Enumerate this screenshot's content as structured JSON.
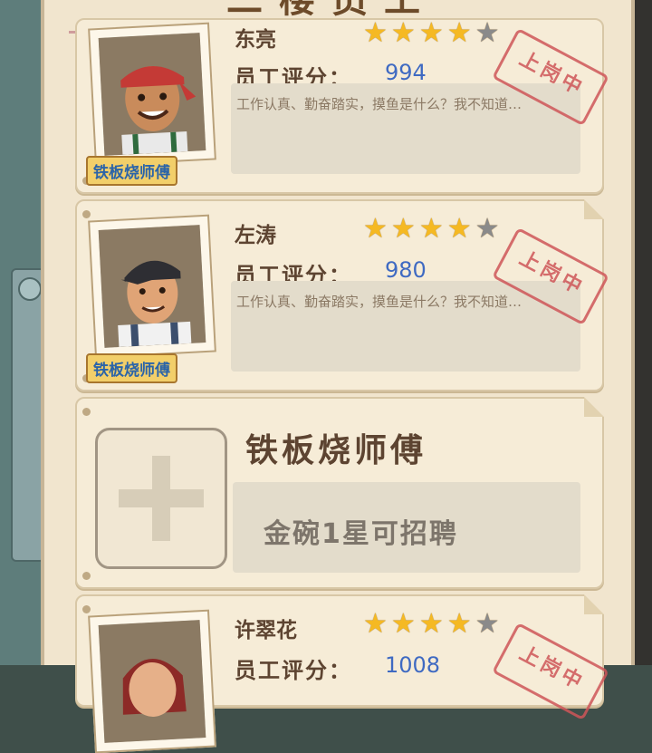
{
  "header": {
    "title": "二楼员工"
  },
  "employees": [
    {
      "name": "东亮",
      "role": "铁板烧师傅",
      "score_label": "员工评分：",
      "score": "994",
      "description": "工作认真、勤奋踏实，摸鱼是什么？我不知道…",
      "status": "上岗中",
      "stars": 4
    },
    {
      "name": "左涛",
      "role": "铁板烧师傅",
      "score_label": "员工评分：",
      "score": "980",
      "description": "工作认真、勤奋踏实，摸鱼是什么？我不知道…",
      "status": "上岗中",
      "stars": 4
    },
    {
      "name": "许翠花",
      "role": "",
      "score_label": "员工评分：",
      "score": "1008",
      "description": "",
      "status": "上岗中",
      "stars": 4
    }
  ],
  "vacancy": {
    "title": "铁板烧师傅",
    "requirement": "金碗1星可招聘"
  },
  "colors": {
    "star_on": "#f5b923",
    "star_off": "#8a8a8a",
    "score": "#3f6ac2",
    "stamp": "#cf5659"
  }
}
